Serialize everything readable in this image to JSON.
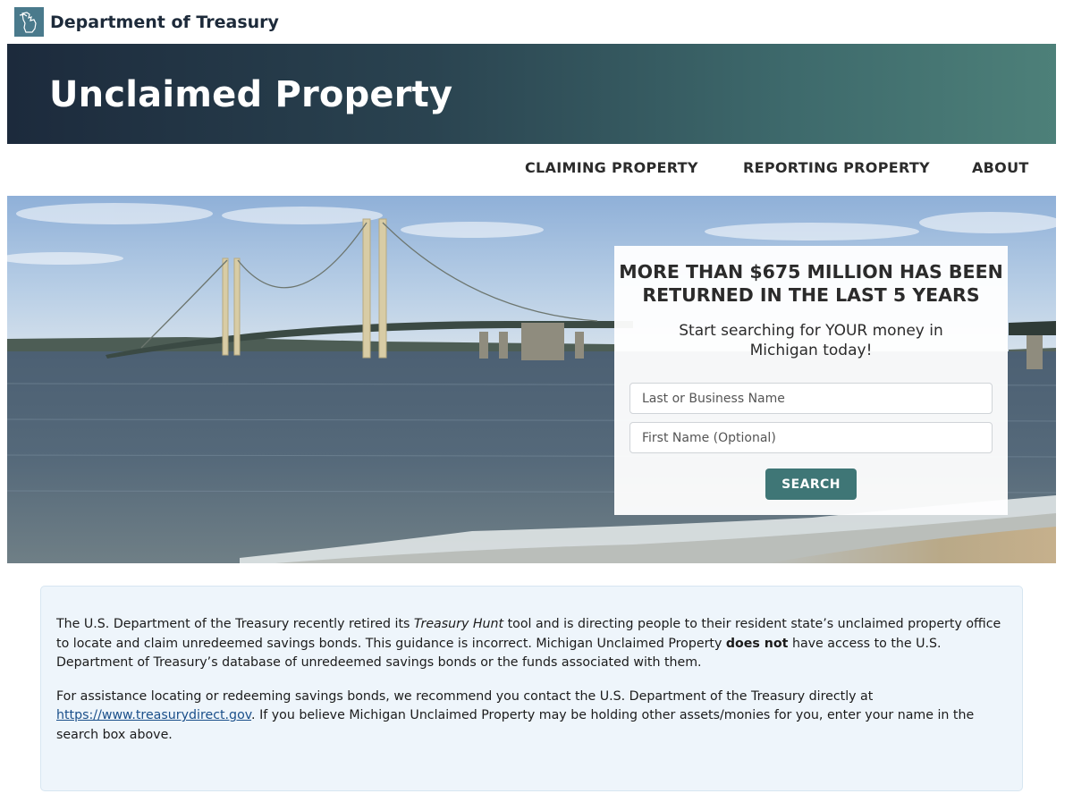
{
  "agency": {
    "name": "Department of Treasury",
    "logo_icon": "michigan-state-icon"
  },
  "banner": {
    "title": "Unclaimed Property"
  },
  "nav": {
    "items": [
      {
        "label": "CLAIMING PROPERTY"
      },
      {
        "label": "REPORTING PROPERTY"
      },
      {
        "label": "ABOUT"
      }
    ]
  },
  "search": {
    "headline_line1": "MORE THAN $675 MILLION HAS BEEN",
    "headline_line2": "RETURNED IN THE LAST 5 YEARS",
    "subtext_line1": "Start searching for YOUR money in",
    "subtext_line2": "Michigan today!",
    "last_name_placeholder": "Last or Business Name",
    "first_name_placeholder": "First Name (Optional)",
    "button_label": "SEARCH"
  },
  "notice": {
    "p1_a": "The U.S. Department of the Treasury recently retired its ",
    "p1_em": "Treasury Hunt",
    "p1_b": " tool and is directing people to their resident state’s unclaimed property office to locate and claim unredeemed savings bonds. This guidance is incorrect. Michigan Unclaimed Property ",
    "p1_strong": "does not",
    "p1_c": " have access to the U.S. Department of Treasury’s database of unredeemed savings bonds or the funds associated with them.",
    "p2_a": "For assistance locating or redeeming savings bonds, we recommend you contact the U.S. Department of the Treasury directly at ",
    "p2_link": "https://www.treasurydirect.gov",
    "p2_b": ". If you believe Michigan Unclaimed Property may be holding other assets/monies for you, enter your name in the search box above."
  },
  "colors": {
    "banner_start": "#1c2a3c",
    "banner_end": "#4d8079",
    "accent_button": "#3f7676",
    "notice_bg": "#eef5fb",
    "link": "#1a4f8a"
  }
}
